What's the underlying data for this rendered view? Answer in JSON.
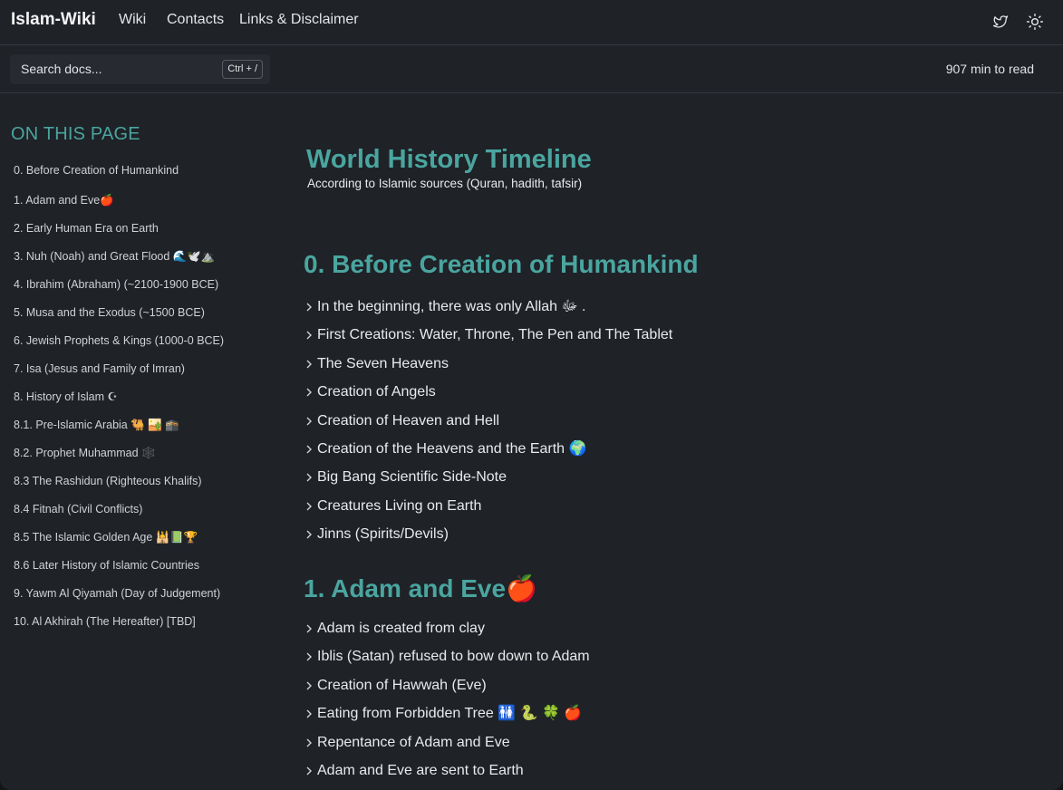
{
  "header": {
    "brand": "Islam-Wiki",
    "nav": [
      "Wiki",
      "Contacts",
      "Links & Disclaimer"
    ],
    "icons": [
      "twitter-icon",
      "sun-icon"
    ]
  },
  "search": {
    "placeholder": "Search docs...",
    "shortcut": "Ctrl + /"
  },
  "read_time": "907 min to read",
  "toc": {
    "title": "ON THIS PAGE",
    "items": [
      "0. Before Creation of Humankind",
      "1. Adam and Eve🍎",
      "2. Early Human Era on Earth",
      "3. Nuh (Noah) and Great Flood 🌊🕊️⛰️",
      "4. Ibrahim (Abraham) (~2100-1900 BCE)",
      "5. Musa and the Exodus (~1500 BCE)",
      "6. Jewish Prophets & Kings (1000-0 BCE)",
      "7. Isa (Jesus and Family of Imran)",
      "8. History of Islam ☪",
      "8.1. Pre-Islamic Arabia 🐫 🏜️ 🕋",
      "8.2. Prophet Muhammad 🕸️",
      "8.3 The Rashidun (Righteous Khalifs)",
      "8.4 Fitnah (Civil Conflicts)",
      "8.5 The Islamic Golden Age 🕌📗🏆",
      "8.6 Later History of Islamic Countries",
      "9. Yawm Al Qiyamah (Day of Judgement)",
      "10. Al Akhirah (The Hereafter) [TBD]"
    ]
  },
  "main": {
    "title": "World History Timeline",
    "subtitle": "According to Islamic sources (Quran, hadith, tafsir)",
    "sections": [
      {
        "heading": "0. Before Creation of Humankind",
        "items": [
          "In the beginning, there was only Allah ﷻ .",
          "First Creations: Water, Throne, The Pen and The Tablet",
          "The Seven Heavens",
          "Creation of Angels",
          "Creation of Heaven and Hell",
          "Creation of the Heavens and the Earth 🌍",
          "Big Bang Scientific Side-Note",
          "Creatures Living on Earth",
          "Jinns (Spirits/Devils)"
        ]
      },
      {
        "heading": "1. Adam and Eve🍎",
        "items": [
          "Adam is created from clay",
          "Iblis (Satan) refused to bow down to Adam",
          "Creation of Hawwah (Eve)",
          "Eating from Forbidden Tree 🚻 🐍 🍀 🍎",
          "Repentance of Adam and Eve",
          "Adam and Eve are sent to Earth"
        ]
      }
    ]
  },
  "colors": {
    "accent": "#4aa5a0",
    "background": "#1f2227",
    "text": "#e8eaec"
  }
}
